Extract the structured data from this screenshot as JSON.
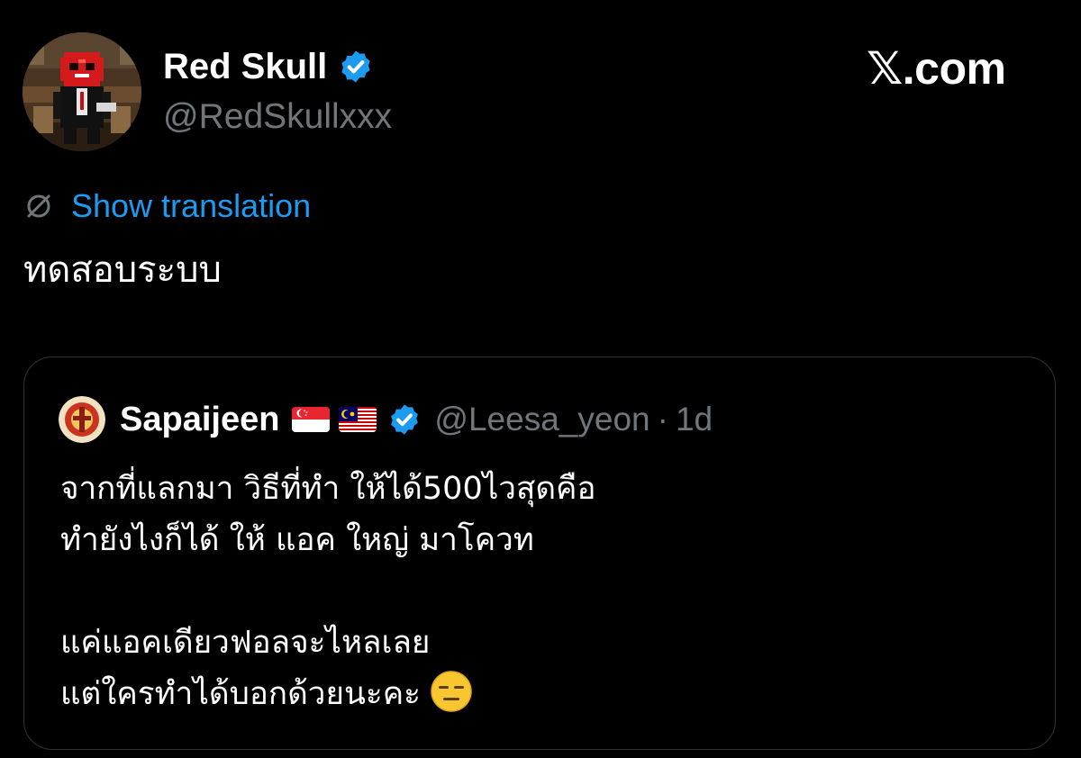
{
  "post": {
    "author": {
      "name": "Red Skull",
      "handle": "@RedSkullxxx",
      "verified": true,
      "avatar": "pixel-art-red-skull-avatar-icon"
    },
    "brand": "𝕏.com",
    "translate_label": "Show translation",
    "text": "ทดสอบระบบ"
  },
  "quote": {
    "author": {
      "name": "Sapaijeen",
      "flags": [
        "singapore-flag-icon",
        "malaysia-flag-icon"
      ],
      "handle": "@Leesa_yeon",
      "verified": true
    },
    "separator": "·",
    "time": "1d",
    "lines": [
      "จากที่แลกมา วิธีที่ทำ ให้ได้500ไวสุดคือ",
      "ทำยังไงก็ได้ ให้ แอค ใหญ่ มาโควท",
      "",
      "แค่แอคเดียวฟอลจะไหลเลย",
      "แต่ใครทำได้บอกด้วยนะคะ"
    ],
    "trailing_emoji": "expressionless-face-icon"
  },
  "colors": {
    "background": "#000000",
    "accent": "#1d9bf0",
    "secondary_text": "#71767b",
    "card_border": "#2f3336"
  }
}
